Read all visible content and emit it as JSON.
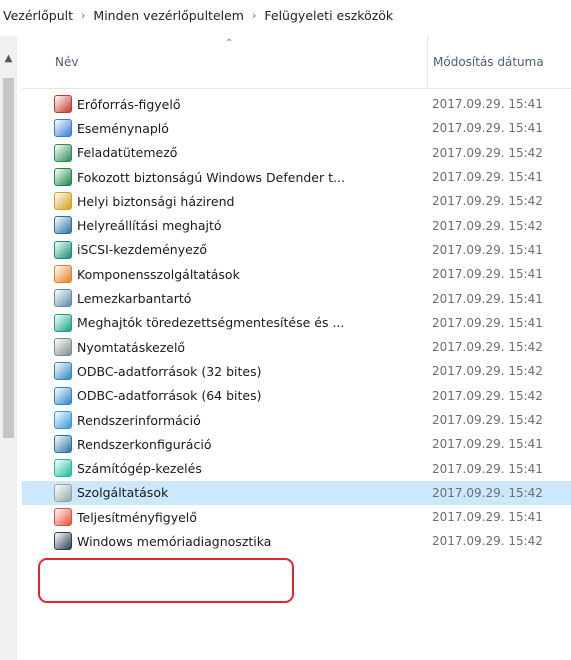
{
  "breadcrumb": {
    "items": [
      "Vezérlőpult",
      "Minden vezérlőpultelem",
      "Felügyeleti eszközök"
    ],
    "separator": "›"
  },
  "header": {
    "name_label": "Név",
    "date_label": "Módosítás dátuma",
    "sort_direction": "ascending"
  },
  "colors": {
    "selected_row": "#cce8ff",
    "highlight_box": "#e2262c"
  },
  "rows": [
    {
      "name": "Erőforrás-figyelő",
      "date": "2017.09.29. 15:41",
      "icon": "resource-monitor-icon",
      "color": "#c0392b",
      "selected": false
    },
    {
      "name": "Eseménynapló",
      "date": "2017.09.29. 15:41",
      "icon": "event-viewer-icon",
      "color": "#3a7bd5",
      "selected": false
    },
    {
      "name": "Feladatütemező",
      "date": "2017.09.29. 15:42",
      "icon": "task-scheduler-icon",
      "color": "#2e8b57",
      "selected": false
    },
    {
      "name": "Fokozott biztonságú Windows Defender t...",
      "date": "2017.09.29. 15:41",
      "icon": "firewall-icon",
      "color": "#1e8449",
      "selected": false
    },
    {
      "name": "Helyi biztonsági házirend",
      "date": "2017.09.29. 15:42",
      "icon": "security-policy-icon",
      "color": "#d4a017",
      "selected": false
    },
    {
      "name": "Helyreállítási meghajtó",
      "date": "2017.09.29. 15:42",
      "icon": "recovery-drive-icon",
      "color": "#2471a3",
      "selected": false
    },
    {
      "name": "iSCSI-kezdeményező",
      "date": "2017.09.29. 15:41",
      "icon": "iscsi-icon",
      "color": "#138d75",
      "selected": false
    },
    {
      "name": "Komponensszolgáltatások",
      "date": "2017.09.29. 15:41",
      "icon": "component-services-icon",
      "color": "#e67e22",
      "selected": false
    },
    {
      "name": "Lemezkarbantartó",
      "date": "2017.09.29. 15:41",
      "icon": "disk-cleanup-icon",
      "color": "#5d8aa8",
      "selected": false
    },
    {
      "name": "Meghajtók töredezettségmentesítése és ...",
      "date": "2017.09.29. 15:41",
      "icon": "defragment-icon",
      "color": "#16a085",
      "selected": false
    },
    {
      "name": "Nyomtatáskezelő",
      "date": "2017.09.29. 15:42",
      "icon": "print-management-icon",
      "color": "#7f8c8d",
      "selected": false
    },
    {
      "name": "ODBC-adatforrások (32 bites)",
      "date": "2017.09.29. 15:42",
      "icon": "odbc-icon",
      "color": "#2e86c1",
      "selected": false
    },
    {
      "name": "ODBC-adatforrások (64 bites)",
      "date": "2017.09.29. 15:42",
      "icon": "odbc-icon",
      "color": "#2e86c1",
      "selected": false
    },
    {
      "name": "Rendszerinformáció",
      "date": "2017.09.29. 15:42",
      "icon": "system-information-icon",
      "color": "#3498db",
      "selected": false
    },
    {
      "name": "Rendszerkonfiguráció",
      "date": "2017.09.29. 15:41",
      "icon": "system-configuration-icon",
      "color": "#2874a6",
      "selected": false
    },
    {
      "name": "Számítógép-kezelés",
      "date": "2017.09.29. 15:41",
      "icon": "computer-management-icon",
      "color": "#1abc9c",
      "selected": false
    },
    {
      "name": "Szolgáltatások",
      "date": "2017.09.29. 15:42",
      "icon": "services-icon",
      "color": "#95a5a6",
      "selected": true
    },
    {
      "name": "Teljesítményfigyelő",
      "date": "2017.09.29. 15:41",
      "icon": "performance-monitor-icon",
      "color": "#e74c3c",
      "selected": false
    },
    {
      "name": "Windows memóriadiagnosztika",
      "date": "2017.09.29. 15:42",
      "icon": "memory-diagnostic-icon",
      "color": "#2e4053",
      "selected": false
    }
  ]
}
